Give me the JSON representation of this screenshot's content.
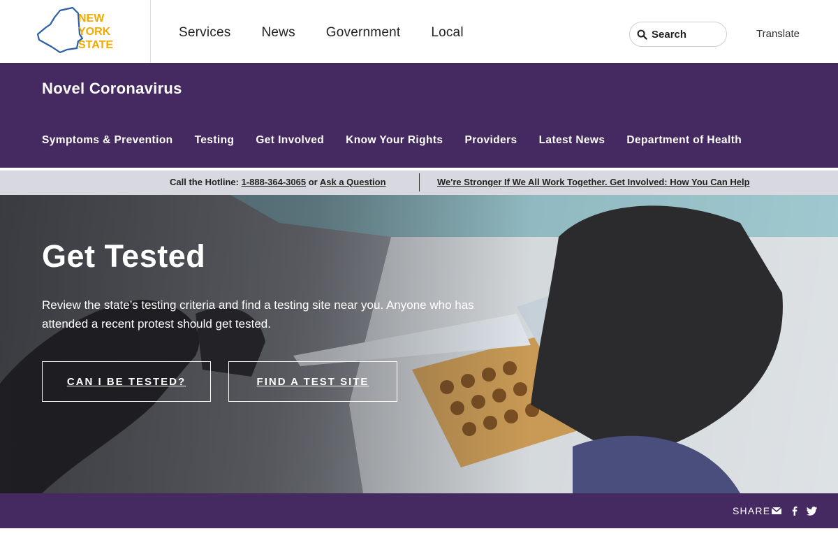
{
  "header": {
    "logo_text": [
      "NEW",
      "YORK",
      "STATE"
    ],
    "nav": [
      "Services",
      "News",
      "Government",
      "Local"
    ],
    "search_label": "Search",
    "translate_label": "Translate"
  },
  "subheader": {
    "title": "Novel Coronavirus",
    "nav": [
      "Symptoms & Prevention",
      "Testing",
      "Get Involved",
      "Know Your Rights",
      "Providers",
      "Latest News",
      "Department of Health"
    ]
  },
  "hotline": {
    "prefix": "Call the Hotline:",
    "phone": "1-888-364-3065",
    "or": "or",
    "ask": "Ask a Question",
    "message": "We're Stronger If We All Work Together. Get Involved: How You Can Help"
  },
  "hero": {
    "title": "Get Tested",
    "body": "Review the state’s testing criteria and find a testing site near you. Anyone who has attended a recent protest should get tested.",
    "button_1": "CAN I BE TESTED?",
    "button_2": "FIND A TEST SITE"
  },
  "share": {
    "label": "SHARE",
    "icons": [
      "email-icon",
      "facebook-icon",
      "twitter-icon"
    ]
  },
  "colors": {
    "brand_purple": "#452961",
    "logo_blue": "#2a5ea8",
    "logo_gold": "#f2a900",
    "hotline_bg": "#d8d8e0"
  }
}
